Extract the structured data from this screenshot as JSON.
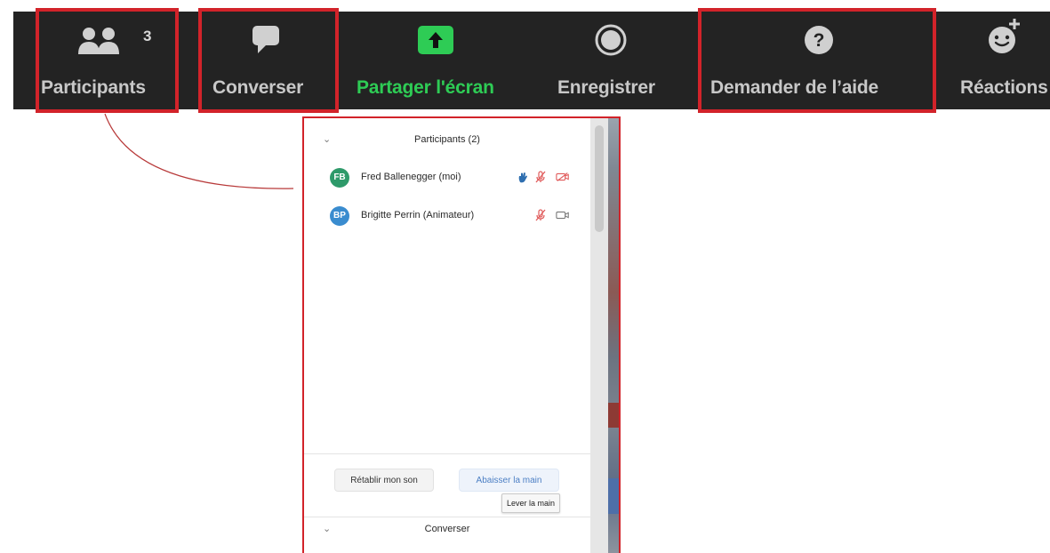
{
  "toolbar": {
    "participants": {
      "label": "Participants",
      "count": "3",
      "icon": "participants-icon"
    },
    "chat": {
      "label": "Converser",
      "icon": "chat-icon"
    },
    "share": {
      "label": "Partager l'écran",
      "icon": "share-screen-icon"
    },
    "record": {
      "label": "Enregistrer",
      "icon": "record-icon"
    },
    "help": {
      "label": "Demander de l’aide",
      "icon": "help-icon"
    },
    "reactions": {
      "label": "Réactions",
      "icon": "reactions-icon"
    }
  },
  "participants_panel": {
    "title": "Participants (2)",
    "participants": [
      {
        "initials": "FB",
        "name": "Fred Ballenegger (moi)",
        "avatar_color": "#2e9a6a",
        "hand_raised": true,
        "muted": true,
        "video_off": true
      },
      {
        "initials": "BP",
        "name": "Brigitte Perrin (Animateur)",
        "avatar_color": "#3a8ccf",
        "hand_raised": false,
        "muted": true,
        "video_off": false
      }
    ],
    "unmute_button": "Rétablir mon son",
    "lower_hand_button": "Abaisser la main",
    "tooltip": "Lever la main"
  },
  "chat_section": {
    "title": "Converser"
  },
  "colors": {
    "toolbar_bg": "#232323",
    "highlight": "#d2232a",
    "share_green": "#2ecc55",
    "muted_red": "#e05a5a"
  }
}
